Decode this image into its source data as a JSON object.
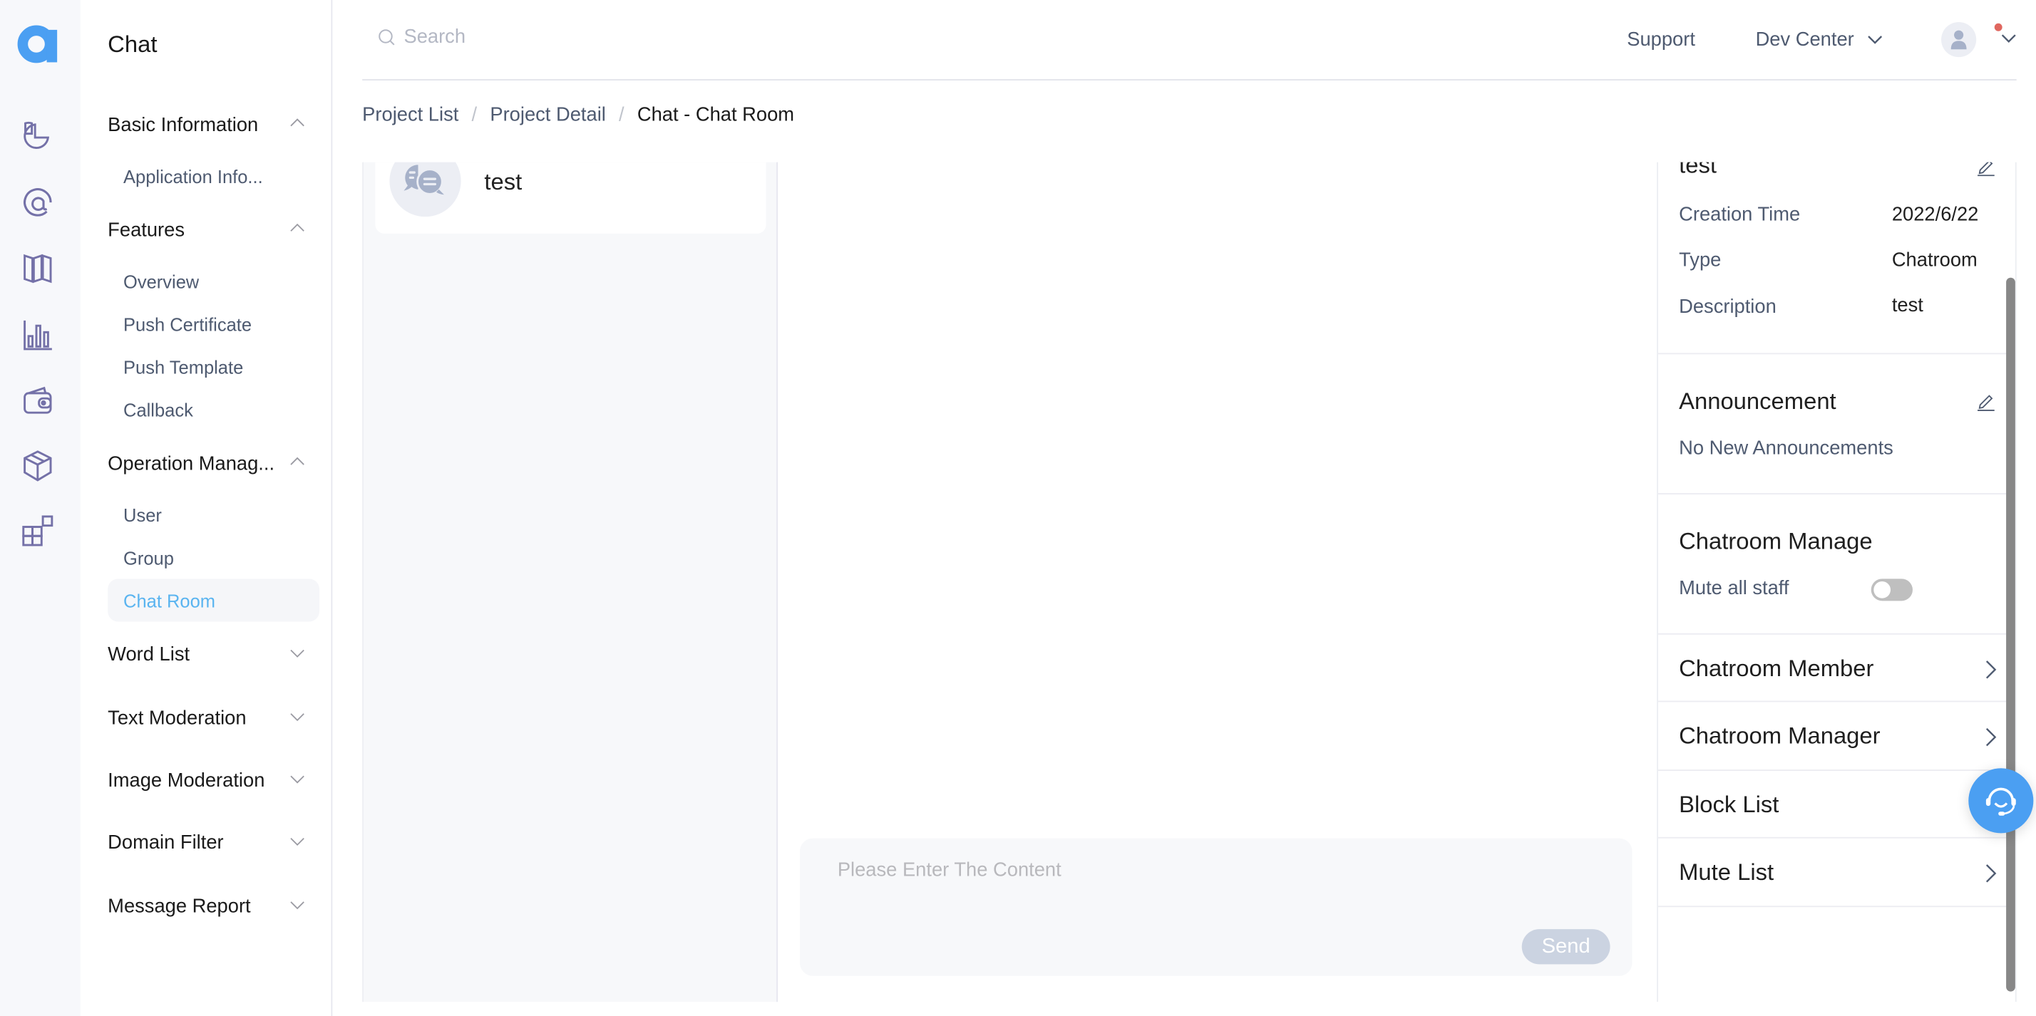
{
  "app": {
    "logo_icon": "brand-logo-a",
    "title": "Chat",
    "accent_color": "#4B9FF2"
  },
  "rail": {
    "icons": [
      "pie-chart-icon",
      "at-sign-icon",
      "map-icon",
      "bar-chart-icon",
      "wallet-icon",
      "box-icon",
      "apps-grid-icon"
    ]
  },
  "nav": {
    "groups": [
      {
        "label": "Basic Information",
        "expanded": true,
        "items": [
          "Application Info..."
        ]
      },
      {
        "label": "Features",
        "expanded": true,
        "items": [
          "Overview",
          "Push Certificate",
          "Push Template",
          "Callback"
        ]
      },
      {
        "label": "Operation Manag...",
        "expanded": true,
        "items": [
          "User",
          "Group",
          "Chat Room"
        ]
      },
      {
        "label": "Word List",
        "expanded": false,
        "items": []
      },
      {
        "label": "Text Moderation",
        "expanded": false,
        "items": []
      },
      {
        "label": "Image Moderation",
        "expanded": false,
        "items": []
      },
      {
        "label": "Domain Filter",
        "expanded": false,
        "items": []
      },
      {
        "label": "Message Report",
        "expanded": false,
        "items": []
      }
    ],
    "active_item": "Chat Room"
  },
  "header": {
    "search_placeholder": "Search",
    "support": "Support",
    "dev_center": "Dev Center",
    "notification_dot": true
  },
  "breadcrumb": {
    "items": [
      "Project List",
      "Project Detail",
      "Chat - Chat Room"
    ],
    "separator": "/"
  },
  "rooms": {
    "items": [
      {
        "name": "test",
        "icon": "chat-bubbles-icon"
      }
    ]
  },
  "compose": {
    "placeholder": "Please Enter The Content",
    "value": "",
    "send_label": "Send",
    "send_enabled": false
  },
  "info": {
    "room_name": "test",
    "fields": [
      {
        "label": "Creation Time",
        "value": "2022/6/22"
      },
      {
        "label": "Type",
        "value": "Chatroom"
      },
      {
        "label": "Description",
        "value": "test"
      }
    ],
    "announcement": {
      "title": "Announcement",
      "text": "No New Announcements"
    },
    "manage": {
      "title": "Chatroom Manage",
      "mute_all_label": "Mute all staff",
      "mute_all_on": false
    },
    "links": [
      "Chatroom Member",
      "Chatroom Manager",
      "Block List",
      "Mute List"
    ]
  }
}
